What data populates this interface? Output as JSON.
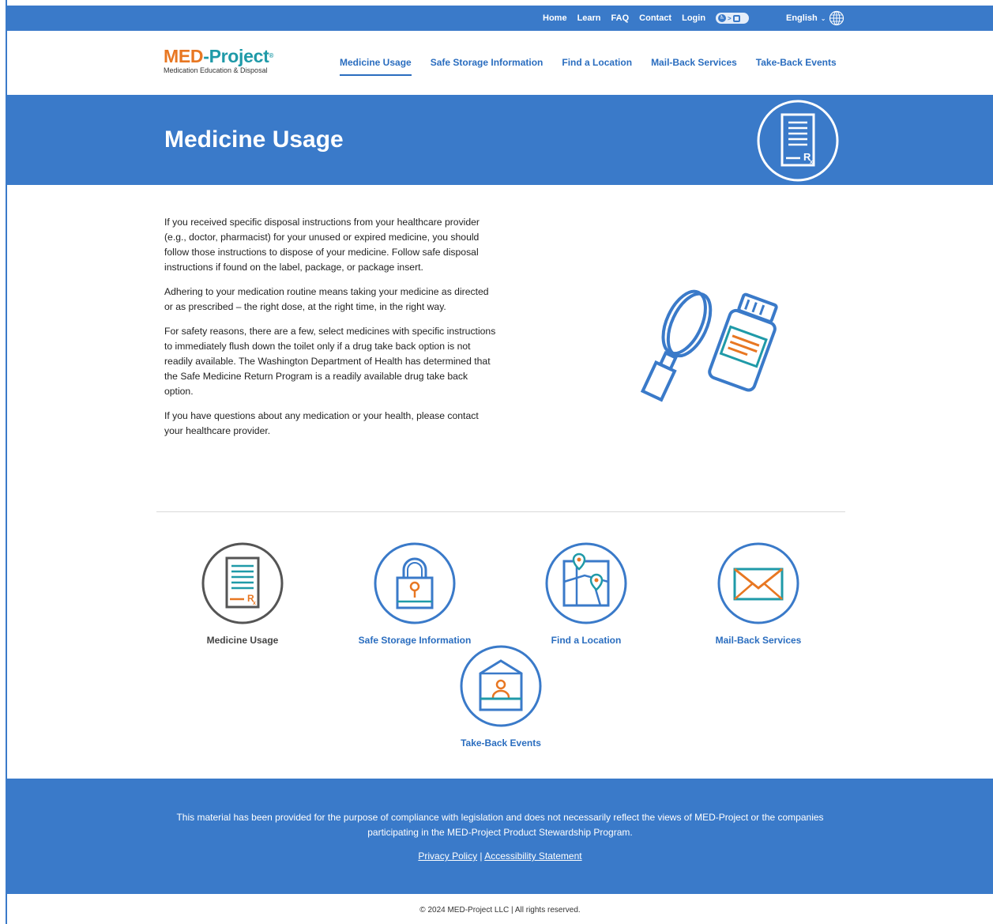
{
  "topbar": {
    "links": [
      "Home",
      "Learn",
      "FAQ",
      "Contact",
      "Login"
    ],
    "language": "English"
  },
  "logo": {
    "med": "MED",
    "dash_project": "-Project",
    "reg": "®",
    "tagline": "Medication Education & Disposal"
  },
  "nav": {
    "items": [
      "Medicine Usage",
      "Safe Storage Information",
      "Find a Location",
      "Mail-Back Services",
      "Take-Back Events"
    ],
    "active": "Medicine Usage"
  },
  "hero": {
    "title": "Medicine Usage",
    "icon": "prescription-document-icon"
  },
  "content": {
    "paragraphs": [
      "If you received specific disposal instructions from your healthcare provider (e.g., doctor, pharmacist) for your unused or expired medicine, you should follow those instructions to dispose of your medicine.  Follow safe disposal instructions if found on the label, package, or package insert.",
      "Adhering to your medication routine means taking your medicine as directed or as prescribed – the right dose, at the right time, in the right way.",
      "For safety reasons, there are a few, select medicines with specific instructions to immediately flush down the toilet only if a drug take back option is not readily available. The Washington Department of Health has determined that the Safe Medicine Return Program is a readily available drug take back option.",
      "If you have questions about any medication or your health, please contact your healthcare provider."
    ],
    "illustration": "magnifier-and-pill-bottle-icon"
  },
  "tiles": [
    {
      "label": "Medicine Usage",
      "icon": "prescription-icon"
    },
    {
      "label": "Safe Storage Information",
      "icon": "padlock-icon"
    },
    {
      "label": "Find a Location",
      "icon": "map-pin-icon"
    },
    {
      "label": "Mail-Back Services",
      "icon": "envelope-icon"
    },
    {
      "label": "Take-Back Events",
      "icon": "booth-icon"
    }
  ],
  "footer": {
    "disclaimer": "This material has been provided for the purpose of compliance with legislation and does not necessarily reflect the views of MED-Project or the companies participating in the MED-Project Product Stewardship Program.",
    "privacy": "Privacy Policy",
    "separator": "|",
    "accessibility": "Accessibility Statement",
    "copyright": "© 2024 MED-Project LLC | All rights reserved."
  },
  "colors": {
    "brand_blue": "#3a7ac9",
    "nav_blue": "#2a6dbf",
    "orange": "#e87722",
    "teal": "#1f9aa8"
  }
}
